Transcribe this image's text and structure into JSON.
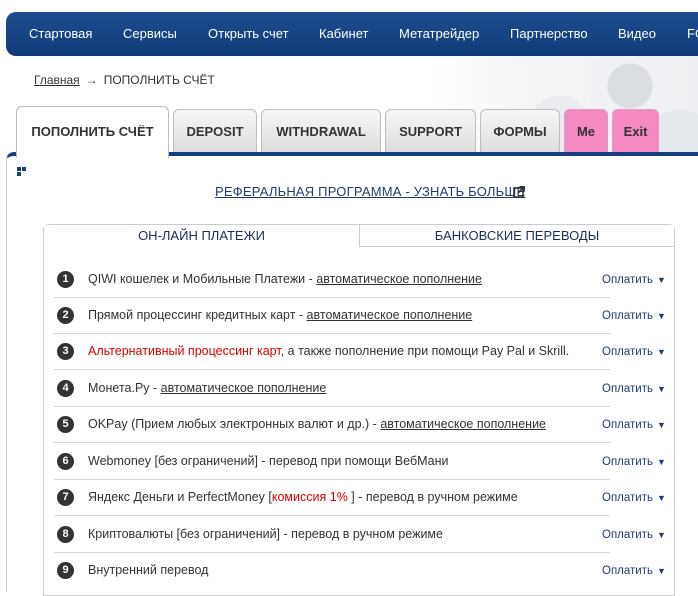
{
  "nav": {
    "items": [
      "Стартовая",
      "Сервисы",
      "Открыть счет",
      "Кабинет",
      "Метатрейдер",
      "Партнерство",
      "Видео",
      "FO"
    ]
  },
  "breadcrumb": {
    "home": "Главная",
    "arrow": "→",
    "current": "ПОПОЛНИТЬ СЧЁТ"
  },
  "tabs": [
    "ПОПОЛНИТЬ СЧЁТ",
    "DEPOSIT",
    "WITHDRAWAL",
    "SUPPORT",
    "ФОРМЫ",
    "Me",
    "Exit"
  ],
  "referral_link": "РЕФЕРАЛЬНАЯ ПРОГРАММА - УЗНАТЬ БОЛЬШЕ",
  "subtabs": [
    "ОН-ЛАЙН ПЛАТЕЖИ",
    "БАНКОВСКИЕ ПЕРЕВОДЫ"
  ],
  "pay_label": "Оплатить",
  "rows": [
    {
      "num": "1",
      "pre": "QIWI кошелек и Мобильные Платежи - ",
      "link": "автоматическое пополнение"
    },
    {
      "num": "2",
      "pre": "Прямой процессинг кредитных карт - ",
      "link": "автоматическое пополнение"
    },
    {
      "num": "3",
      "red": "Альтернативный процессинг карт",
      "post": ", а также пополнение при помощи Pay Pal и Skrill."
    },
    {
      "num": "4",
      "pre": "Монета.Ру - ",
      "link": "автоматическое пополнение"
    },
    {
      "num": "5",
      "pre": "OKPay (Прием любых электронных валют и др.) - ",
      "link": "автоматическое пополнение"
    },
    {
      "num": "6",
      "pre": "Webmoney [без ограничений] - перевод при помощи ВебМани"
    },
    {
      "num": "7",
      "pre": "Яндекс Деньги и PerfectMoney [",
      "red": "комиссия 1%",
      "post": " ] - перевод в ручном режиме"
    },
    {
      "num": "8",
      "pre": "Криптовалюты [без ограничений] - перевод в ручном режиме"
    },
    {
      "num": "9",
      "pre": "Внутренний перевод"
    }
  ],
  "colors": {
    "nav_bg": "#14407f",
    "pink_tab": "#f58ac2",
    "accent_red": "#e00000",
    "link_blue": "#1d3d6e"
  }
}
